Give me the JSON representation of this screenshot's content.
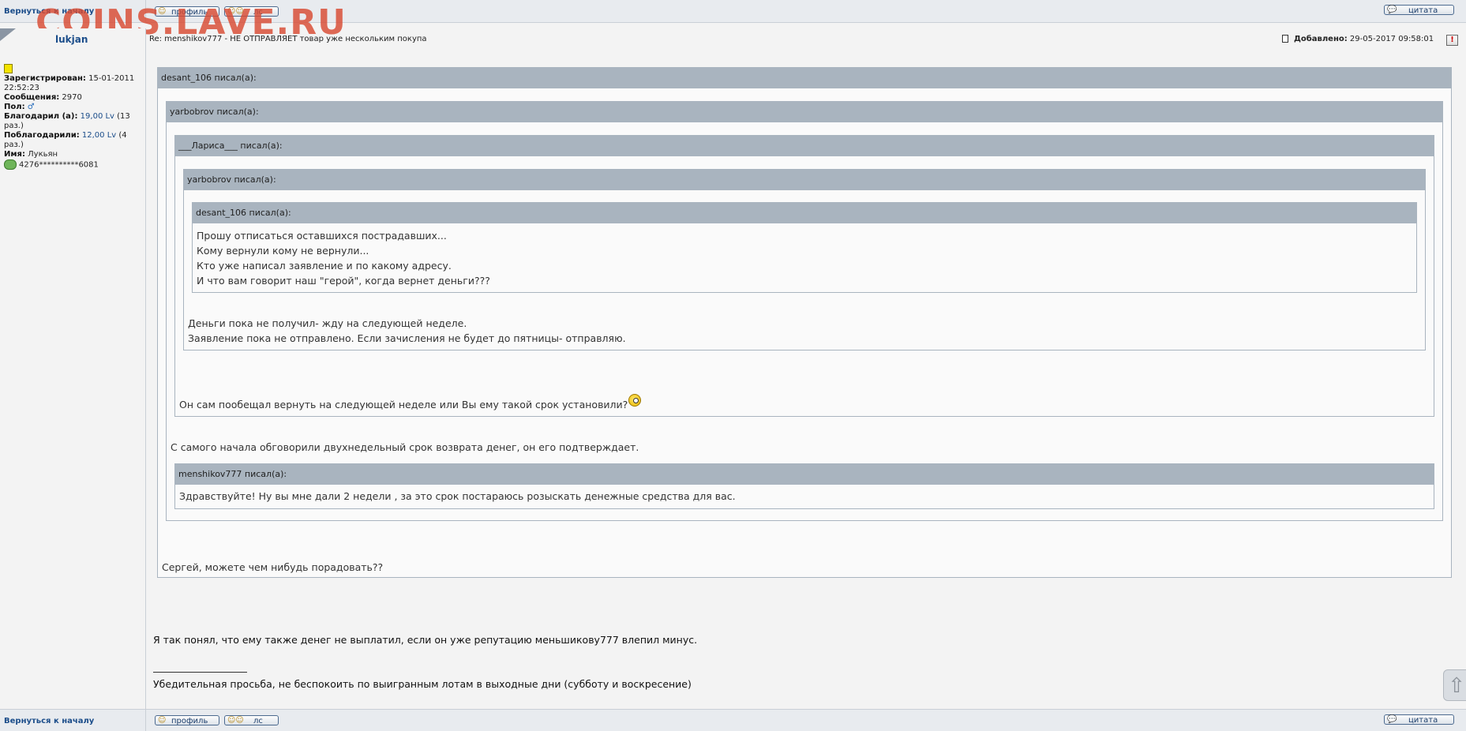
{
  "watermark": "COINS.LAVE.RU",
  "nav": {
    "back_to_top": "Вернуться к началу",
    "profile": "профиль",
    "pm": "лс",
    "quote": "цитата"
  },
  "user": {
    "name": "lukjan",
    "registered_label": "Зарегистрирован:",
    "registered_value": "15-01-2011",
    "registered_time": "22:52:23",
    "messages_label": "Сообщения:",
    "messages_value": "2970",
    "gender_label": "Пол:",
    "thanked_label": "Благодарил (а):",
    "thanked_value": "19,00 Lv",
    "thanked_count": "(13",
    "thanked_count2": "раз.)",
    "thanked_by_label": "Поблагодарили:",
    "thanked_by_value": "12,00 Lv",
    "thanked_by_count": "(4",
    "thanked_by_count2": "раз.)",
    "name_label": "Имя:",
    "name_value": "Лукьян",
    "card": "4276**********6081"
  },
  "post": {
    "subject": "Re: menshikov777 - НЕ ОТПРАВЛЯЕТ товар уже нескольким покупа",
    "added_label": "Добавлено:",
    "added_value": "29-05-2017 09:58:01",
    "report": "!"
  },
  "quotes": {
    "q1_head": "desant_106 писал(а):",
    "q2_head": "yarbobrov писал(а):",
    "q3_head": "___Лариса___ писал(а):",
    "q4_head": "yarbobrov писал(а):",
    "q5_head": "desant_106 писал(а):",
    "q5_lines": [
      "Прошу отписаться оставшихся пострадавших...",
      "Кому вернули кому не вернули...",
      "Кто уже написал заявление и по какому адресу.",
      "И что вам говорит наш \"герой\", когда вернет деньги???"
    ],
    "q4_lines": [
      "Деньги пока не получил- жду на следующей неделе.",
      "Заявление пока не отправлено. Если зачисления не будет до пятницы- отправляю."
    ],
    "q3_text": "Он сам пообещал вернуть на следующей неделе или Вы ему такой срок установили?",
    "q2_text": "С самого начала обговорили двухнедельный срок возврата денег, он его подтверждает.",
    "q6_head": "menshikov777 писал(а):",
    "q6_text": "Здравствуйте! Ну вы мне дали 2 недели , за это срок постараюсь розыскать денежные средства для вас.",
    "q1_text": "Сергей, можете чем нибудь порадовать??"
  },
  "body": {
    "text": "Я так понял, что ему также денег не выплатил, если он уже репутацию меньшикову777 влепил минус.",
    "signature": "Убедительная просьба, не беспокоить по выигранным лотам в выходные дни (субботу и воскресение)"
  },
  "icons": {
    "profile": "profile-icon",
    "pm": "users-icon",
    "quote": "speech-bubble-icon",
    "scroll": "arrow-up-icon"
  }
}
